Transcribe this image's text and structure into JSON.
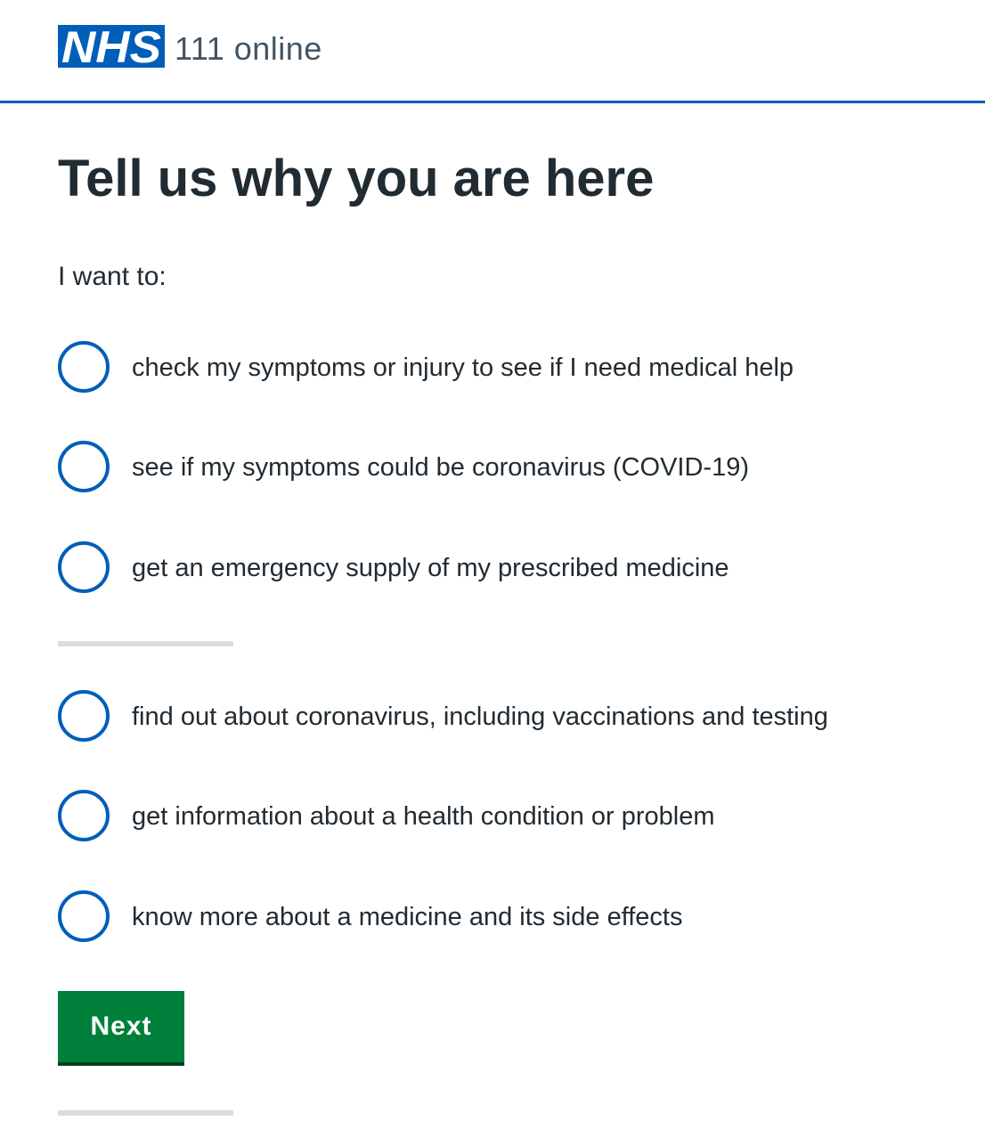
{
  "header": {
    "logo_text": "NHS",
    "service_name": "111 online",
    "brand_color": "#005eb8"
  },
  "page": {
    "title": "Tell us why you are here",
    "hint": "I want to:"
  },
  "options_group_1": [
    {
      "label": "check my symptoms or injury to see if I need medical help",
      "selected": false
    },
    {
      "label": "see if my symptoms could be coronavirus (COVID-19)",
      "selected": false
    },
    {
      "label": "get an emergency supply of my prescribed medicine",
      "selected": false
    }
  ],
  "options_group_2": [
    {
      "label": "find out about coronavirus, including vaccinations and testing",
      "selected": false
    },
    {
      "label": "get information about a health condition or problem",
      "selected": false
    },
    {
      "label": "know more about a medicine and its side effects",
      "selected": false
    }
  ],
  "actions": {
    "next_label": "Next",
    "button_color": "#007f3b"
  },
  "icons": {
    "radio": "radio-unchecked-icon"
  }
}
